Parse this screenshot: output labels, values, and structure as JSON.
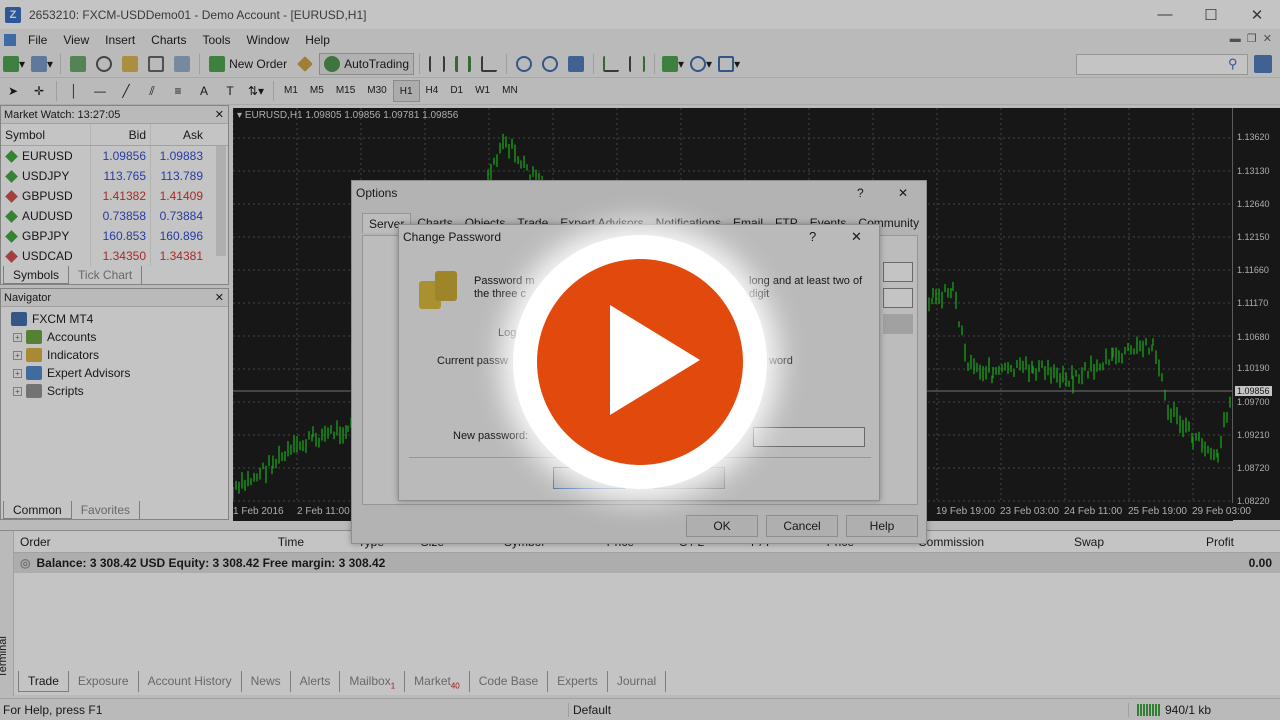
{
  "window": {
    "title": "2653210: FXCM-USDDemo01 - Demo Account - [EURUSD,H1]",
    "min": "—",
    "max": "☐",
    "close": "✕"
  },
  "menu": [
    "File",
    "View",
    "Insert",
    "Charts",
    "Tools",
    "Window",
    "Help"
  ],
  "toolbar": {
    "new_order": "New Order",
    "autotrading": "AutoTrading",
    "timeframes": [
      "M1",
      "M5",
      "M15",
      "M30",
      "H1",
      "H4",
      "D1",
      "W1",
      "MN"
    ],
    "selected_timeframe": "H1",
    "line_tool_a": "A",
    "search_icon": "magnifier-icon"
  },
  "market_watch": {
    "title": "Market Watch: 13:27:05",
    "headers": {
      "symbol": "Symbol",
      "bid": "Bid",
      "ask": "Ask"
    },
    "rows": [
      {
        "symbol": "EURUSD",
        "bid": "1.09856",
        "ask": "1.09883",
        "dir": "up"
      },
      {
        "symbol": "USDJPY",
        "bid": "113.765",
        "ask": "113.789",
        "dir": "up"
      },
      {
        "symbol": "GBPUSD",
        "bid": "1.41382",
        "ask": "1.41409",
        "dir": "down"
      },
      {
        "symbol": "AUDUSD",
        "bid": "0.73858",
        "ask": "0.73884",
        "dir": "up"
      },
      {
        "symbol": "GBPJPY",
        "bid": "160.853",
        "ask": "160.896",
        "dir": "up"
      },
      {
        "symbol": "USDCAD",
        "bid": "1.34350",
        "ask": "1.34381",
        "dir": "down"
      }
    ],
    "tabs": [
      "Symbols",
      "Tick Chart"
    ]
  },
  "navigator": {
    "title": "Navigator",
    "root": "FXCM MT4",
    "items": [
      "Accounts",
      "Indicators",
      "Expert Advisors",
      "Scripts"
    ],
    "tabs": [
      "Common",
      "Favorites"
    ]
  },
  "chart": {
    "info": "EURUSD,H1  1.09805 1.09856 1.09781 1.09856",
    "price_labels": [
      "1.13620",
      "1.13130",
      "1.12640",
      "1.12150",
      "1.11660",
      "1.11170",
      "1.10680",
      "1.10190",
      "1.09856",
      "1.09700",
      "1.09210",
      "1.08720",
      "1.08220"
    ],
    "current_price": "1.09856",
    "time_labels": [
      "1 Feb 2016",
      "2 Feb 11:00",
      "19 Feb 19:00",
      "23 Feb 03:00",
      "24 Feb 11:00",
      "25 Feb 19:00",
      "29 Feb 03:00"
    ]
  },
  "options_dialog": {
    "title": "Options",
    "help": "?",
    "close": "✕",
    "tabs": [
      "Server",
      "Charts",
      "Objects",
      "Trade",
      "Expert Advisors",
      "Notifications",
      "Email",
      "FTP",
      "Events",
      "Community"
    ],
    "ok": "OK",
    "cancel": "Cancel",
    "help_btn": "Help"
  },
  "change_password": {
    "title": "Change Password",
    "help": "?",
    "close": "✕",
    "desc_left": "Password m",
    "desc_left2": "the three c",
    "desc_right": "long and at least two of",
    "desc_right2": "digit",
    "login_label": "Log",
    "current_label": "Current passw",
    "right_label": "word",
    "new_label": "New password:"
  },
  "terminal": {
    "headers": [
      "Order",
      "Time",
      "Type",
      "Size",
      "Symbol",
      "Price",
      "S / L",
      "T / P",
      "Price",
      "Commission",
      "Swap",
      "Profit"
    ],
    "balance_text": "Balance: 3 308.42 USD  Equity: 3 308.42  Free margin: 3 308.42",
    "balance_profit": "0.00",
    "side_label": "Terminal",
    "tabs": [
      {
        "label": "Trade"
      },
      {
        "label": "Exposure"
      },
      {
        "label": "Account History"
      },
      {
        "label": "News"
      },
      {
        "label": "Alerts"
      },
      {
        "label": "Mailbox",
        "badge": "1"
      },
      {
        "label": "Market",
        "badge": "40"
      },
      {
        "label": "Code Base"
      },
      {
        "label": "Experts"
      },
      {
        "label": "Journal"
      }
    ]
  },
  "status": {
    "help": "For Help, press F1",
    "profile": "Default",
    "traffic": "940/1 kb"
  },
  "colors": {
    "play": "#e14a0c",
    "bull_candle": "#00c000",
    "bid_blue": "#1a36c8",
    "bid_red": "#d01d1d"
  }
}
